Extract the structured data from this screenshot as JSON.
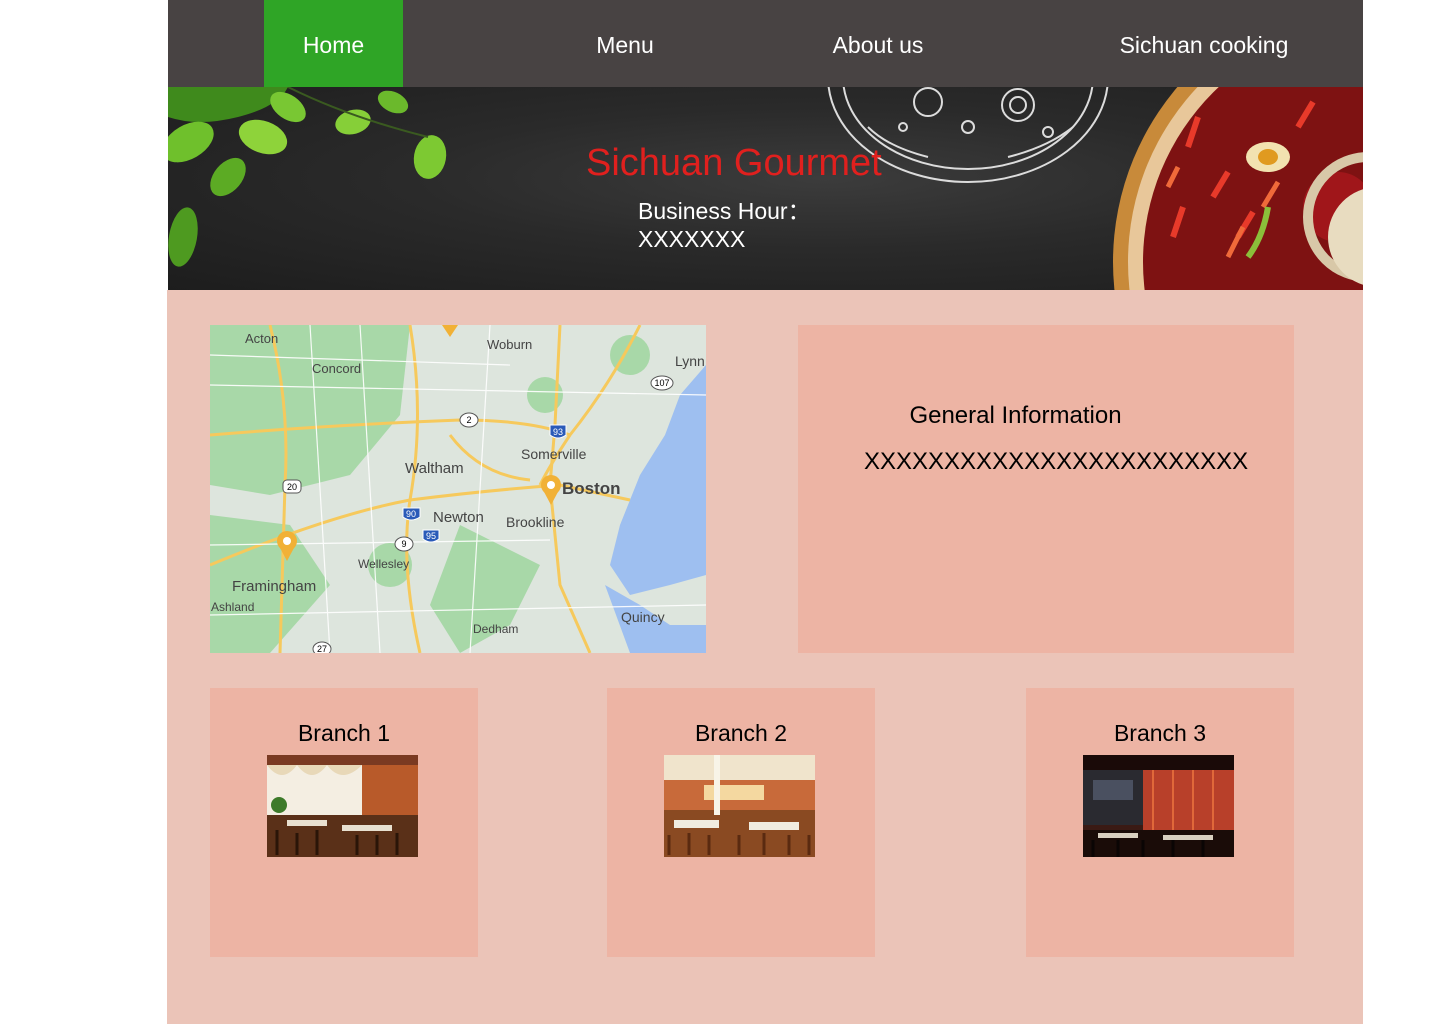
{
  "nav": {
    "items": [
      {
        "label": "Home",
        "active": true
      },
      {
        "label": "Menu",
        "active": false
      },
      {
        "label": "About us",
        "active": false
      },
      {
        "label": "Sichuan cooking",
        "active": false
      }
    ],
    "background": "#484343",
    "active_color": "#2fa526"
  },
  "banner": {
    "title": "Sichuan Gourmet",
    "hours_label": "Business Hour：",
    "hours_value": "XXXXXXX",
    "title_color": "#e0201e"
  },
  "map": {
    "labels": {
      "acton": "Acton",
      "woburn": "Woburn",
      "lynn": "Lynn",
      "concord": "Concord",
      "somerville": "Somerville",
      "waltham": "Waltham",
      "boston": "Boston",
      "newton": "Newton",
      "brookline": "Brookline",
      "wellesley": "Wellesley",
      "framingham": "Framingham",
      "ashland": "Ashland",
      "dedham": "Dedham",
      "quincy": "Quincy"
    },
    "shields": {
      "r107": "107",
      "r2": "2",
      "i93": "93",
      "r20": "20",
      "i90": "90",
      "i95": "95",
      "r9": "9",
      "r27": "27"
    }
  },
  "info": {
    "title": "General Information",
    "body": "XXXXXXXXXXXXXXXXXXXXXXXX"
  },
  "branches": [
    {
      "title": "Branch 1"
    },
    {
      "title": "Branch 2"
    },
    {
      "title": "Branch 3"
    }
  ],
  "colors": {
    "main_background": "#ebc4b8",
    "card_background": "#edb4a4"
  }
}
